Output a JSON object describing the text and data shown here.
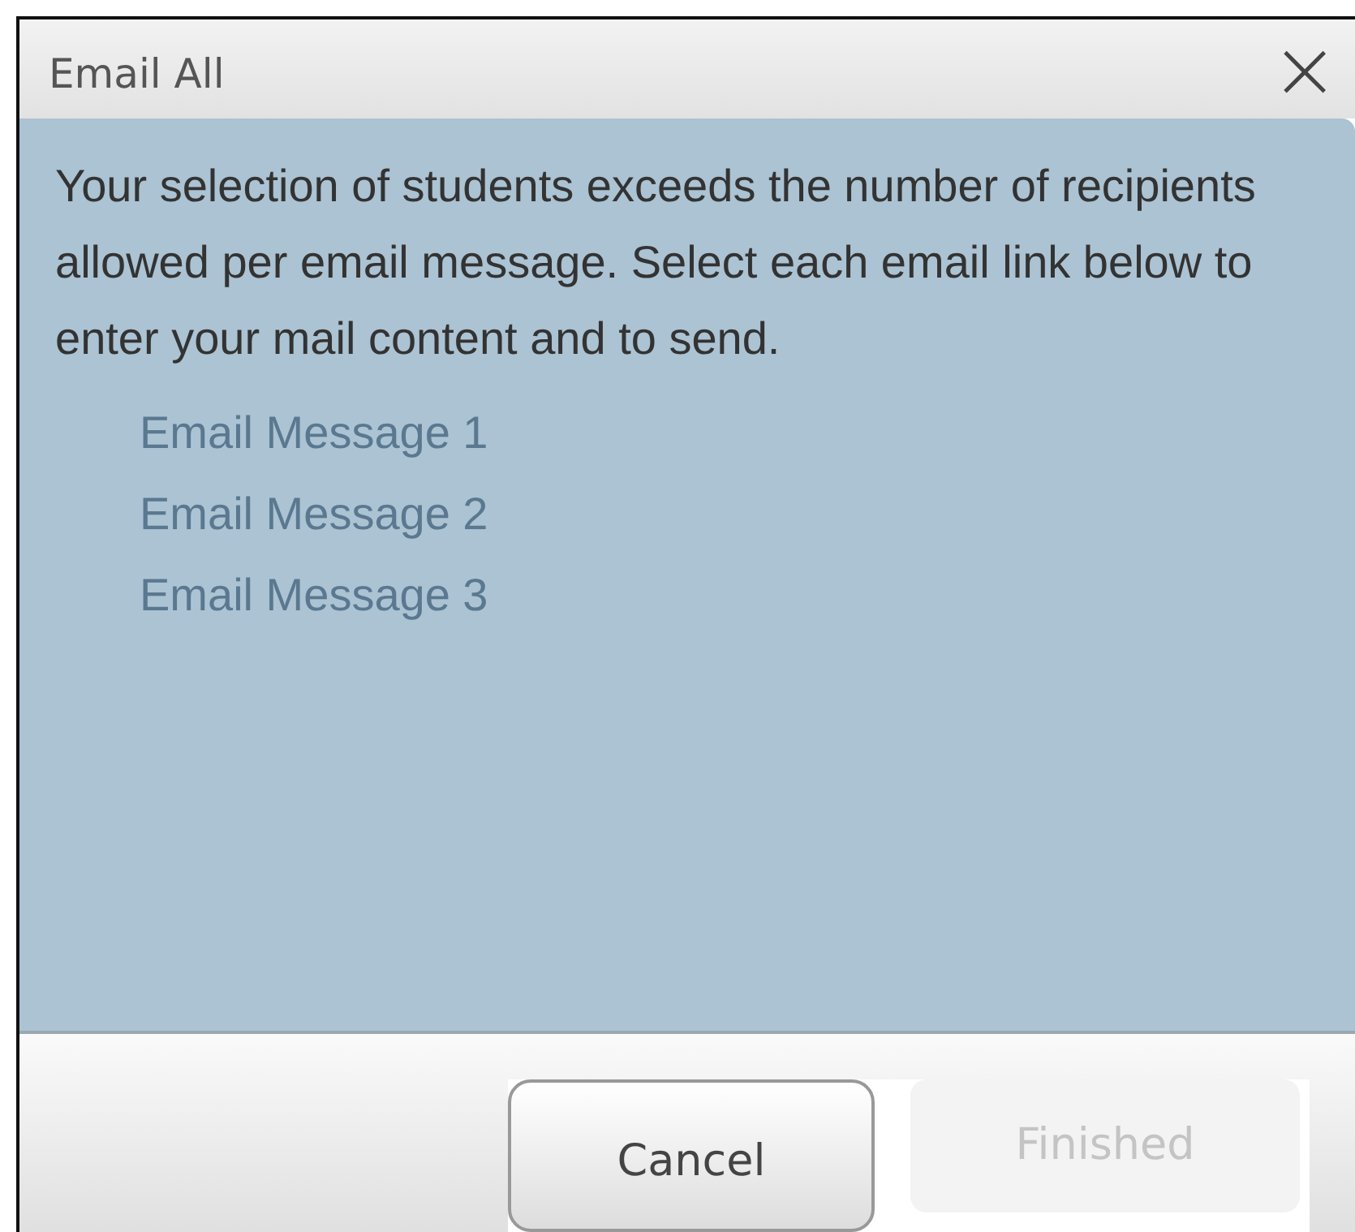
{
  "dialog": {
    "title": "Email All",
    "close": "×"
  },
  "message": "Your selection of students exceeds the number of recipients allowed per email message. Select each email link below to enter your mail content and to send.",
  "links": [
    "Email Message 1",
    "Email Message 2",
    "Email Message 3"
  ],
  "buttons": [
    {
      "label": "Cancel",
      "disabled": false
    },
    {
      "label": "Finished",
      "disabled": true
    }
  ]
}
